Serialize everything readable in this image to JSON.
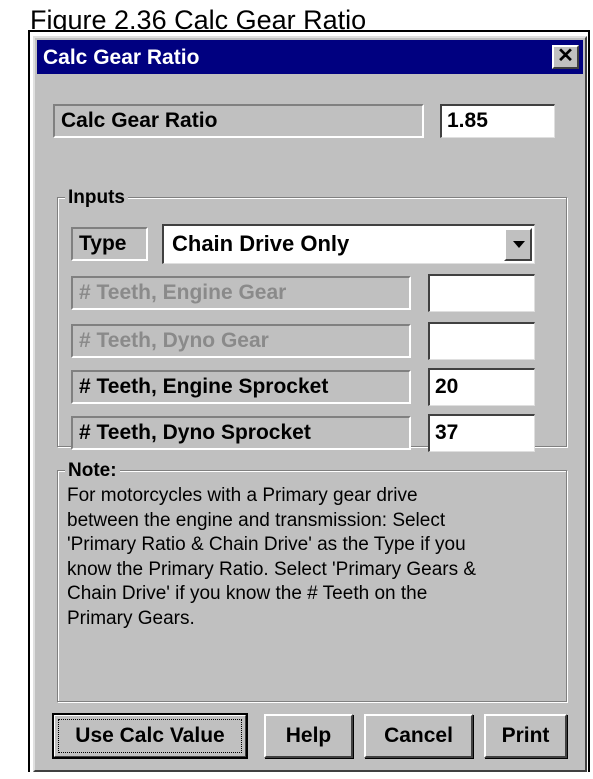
{
  "figure_caption": "Figure 2.36  Calc Gear Ratio",
  "dialog": {
    "title": "Calc Gear Ratio",
    "close_glyph": "✕"
  },
  "result": {
    "label": "Calc Gear Ratio",
    "value": "1.85"
  },
  "inputs": {
    "group_title": "Inputs",
    "type_label": "Type",
    "type_value": "Chain Drive Only",
    "rows": [
      {
        "label": "# Teeth, Engine Gear",
        "value": "",
        "enabled": false
      },
      {
        "label": "# Teeth, Dyno Gear",
        "value": "",
        "enabled": false
      },
      {
        "label": "# Teeth, Engine Sprocket",
        "value": "20",
        "enabled": true
      },
      {
        "label": "# Teeth, Dyno Sprocket",
        "value": "37",
        "enabled": true
      }
    ]
  },
  "note": {
    "title": "Note:",
    "lines": [
      "For motorcycles with a Primary gear drive",
      "between the engine and transmission:  Select",
      "'Primary Ratio & Chain Drive' as the Type if you",
      "know the Primary Ratio.  Select 'Primary Gears &",
      "Chain Drive' if you know the # Teeth on the",
      "Primary Gears."
    ]
  },
  "buttons": {
    "use_calc": "Use Calc Value",
    "help": "Help",
    "cancel": "Cancel",
    "print": "Print"
  }
}
